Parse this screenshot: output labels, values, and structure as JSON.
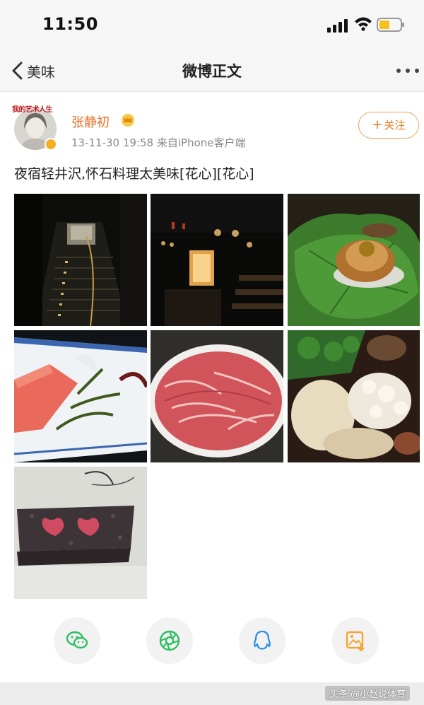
{
  "status_bar": {
    "time": "11:50"
  },
  "nav": {
    "back_label": "美味",
    "title": "微博正文"
  },
  "post": {
    "avatar_caption": "我的艺术人生",
    "username": "张静初",
    "meta": "13-11-30 19:58  来自iPhone客户端",
    "follow_label": "关注",
    "text": "夜宿轻井沢,怀石料理太美味[花心][花心]"
  },
  "share": {
    "icons": [
      "wechat-icon",
      "moments-icon",
      "qq-icon",
      "save-image-icon"
    ]
  },
  "watermark": "头条 @小赵说体育",
  "colors": {
    "accent": "#e86b22",
    "follow_border": "#f0a15a"
  }
}
